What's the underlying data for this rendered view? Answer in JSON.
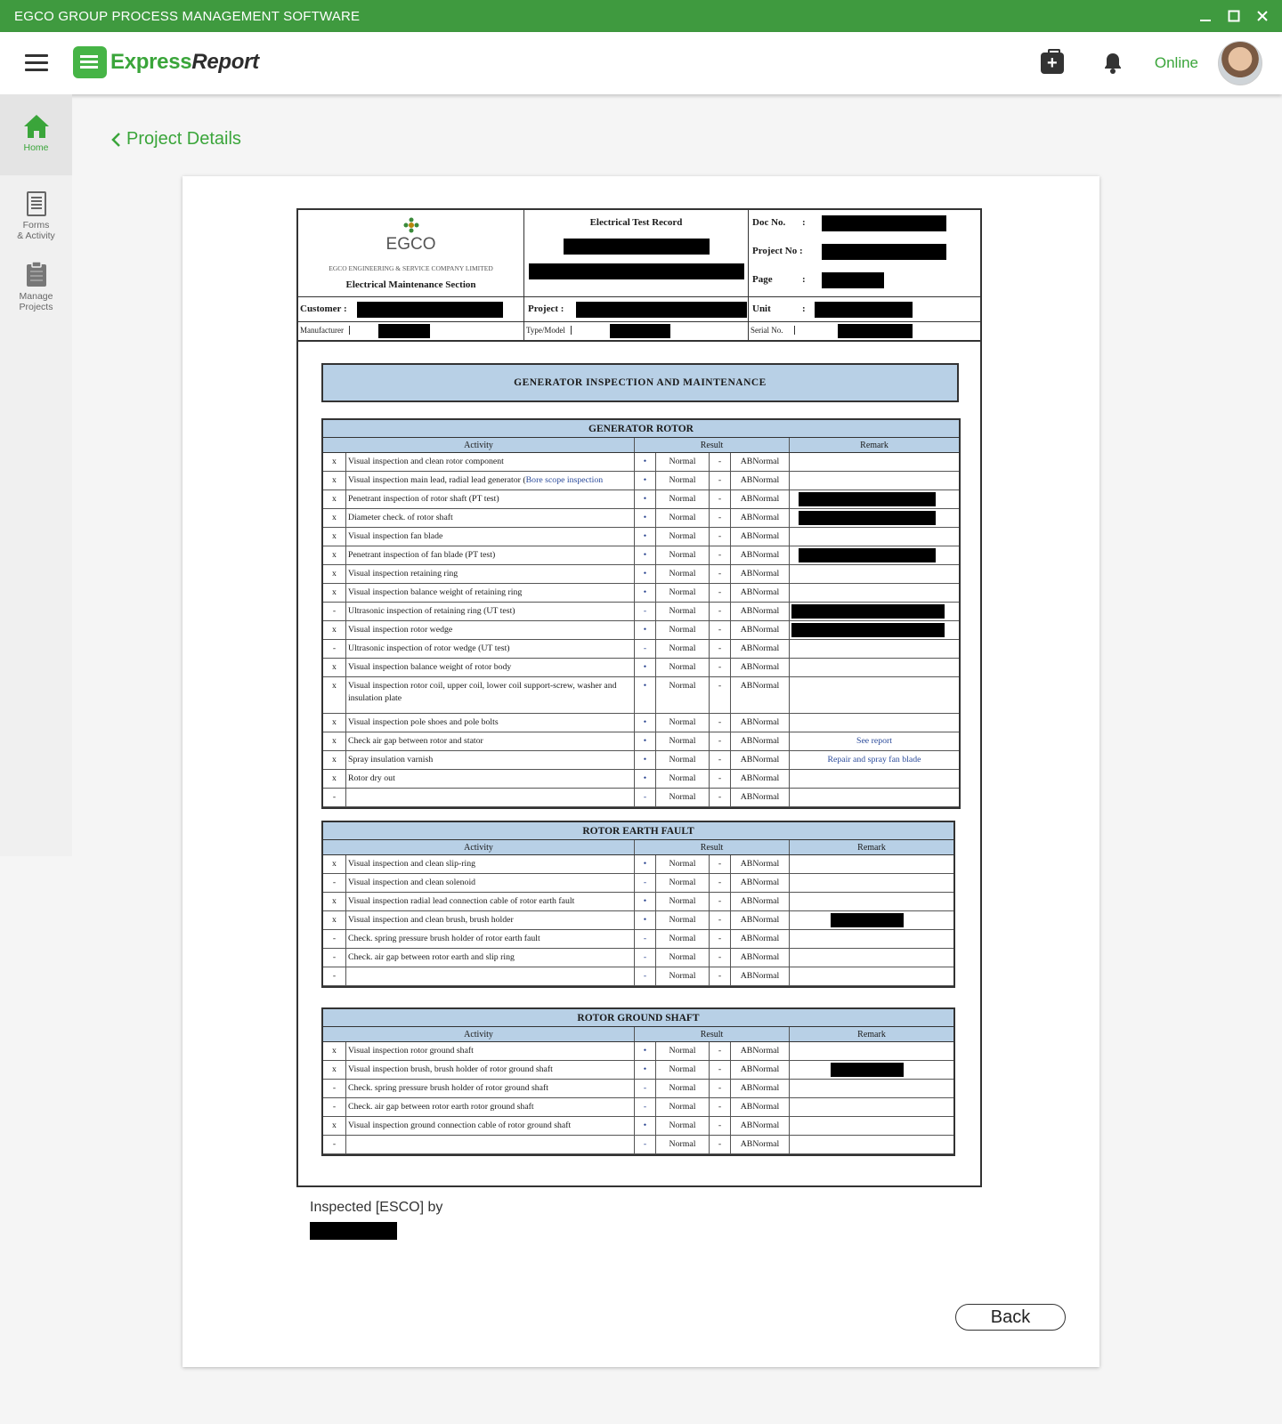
{
  "titlebar": {
    "title": "EGCO GROUP PROCESS MANAGEMENT SOFTWARE"
  },
  "header": {
    "brand_green": "Express",
    "brand_dark": "Report",
    "status": "Online"
  },
  "sidebar": {
    "items": [
      {
        "label_1": "Home",
        "label_2": ""
      },
      {
        "label_1": "Forms",
        "label_2": "& Activity"
      },
      {
        "label_1": "Manage",
        "label_2": "Projects"
      }
    ]
  },
  "breadcrumb": {
    "label": "Project Details"
  },
  "colors": {
    "brand_green": "#3f9a3f",
    "accent_green": "#3aa53a",
    "table_header_blue": "#b8d0e6"
  },
  "doc": {
    "company_logo": "EGCO",
    "company_name": "EGCO ENGINEERING & SERVICE COMPANY LIMITED",
    "section_name": "Electrical Maintenance Section",
    "record_title": "Electrical Test Record",
    "doc_no_label": "Doc No.",
    "project_no_label": "Project No :",
    "page_label": "Page",
    "unit_label": "Unit",
    "customer_label": "Customer :",
    "project_label": "Project :",
    "manufacturer_label": "Manufacturer",
    "type_model_label": "Type/Model",
    "serial_no_label": "Serial No.",
    "colon": ":",
    "banner": "GENERATOR INSPECTION AND MAINTENANCE",
    "col_activity": "Activity",
    "col_result": "Result",
    "col_remark": "Remark",
    "normal": "Normal",
    "abnormal": "ABNormal",
    "dash": "-",
    "rotor_title": "GENERATOR ROTOR",
    "rotor_rows": [
      {
        "mark": "x",
        "activity": "Visual inspection and clean rotor component",
        "dot": "•",
        "remark": ""
      },
      {
        "mark": "x",
        "activity": "Visual inspection main lead, radial lead generator (",
        "activity_blue": "Bore scope inspection",
        "dot": "•",
        "remark": ""
      },
      {
        "mark": "x",
        "activity": "Penetrant inspection of rotor shaft (PT test)",
        "dot": "•",
        "remark": ""
      },
      {
        "mark": "x",
        "activity": "Diameter check. of rotor shaft",
        "dot": "•",
        "remark": ""
      },
      {
        "mark": "x",
        "activity": "Visual inspection fan blade",
        "dot": "•",
        "remark": ""
      },
      {
        "mark": "x",
        "activity": "Penetrant inspection of fan blade (PT test)",
        "dot": "•",
        "remark": ""
      },
      {
        "mark": "x",
        "activity": "Visual inspection retaining ring",
        "dot": "•",
        "remark": ""
      },
      {
        "mark": "x",
        "activity": "Visual inspection balance weight of retaining ring",
        "dot": "•",
        "remark": ""
      },
      {
        "mark": "-",
        "activity": "Ultrasonic inspection of retaining ring (UT test)",
        "dot": "-",
        "remark": ""
      },
      {
        "mark": "x",
        "activity": "Visual inspection rotor wedge",
        "dot": "•",
        "remark": ""
      },
      {
        "mark": "-",
        "activity": "Ultrasonic inspection of rotor wedge (UT test)",
        "dot": "-",
        "remark": ""
      },
      {
        "mark": "x",
        "activity": "Visual inspection balance weight of rotor body",
        "dot": "•",
        "remark": ""
      },
      {
        "mark": "x",
        "activity": "Visual inspection rotor coil, upper coil, lower coil support-screw, washer and insulation plate",
        "dot": "•",
        "remark": ""
      },
      {
        "mark": "x",
        "activity": "Visual inspection pole shoes and pole bolts",
        "dot": "•",
        "remark": ""
      },
      {
        "mark": "x",
        "activity": "Check air gap between rotor and stator",
        "dot": "•",
        "remark": "See report"
      },
      {
        "mark": "x",
        "activity": "Spray insulation varnish",
        "dot": "•",
        "remark": "Repair and spray fan blade"
      },
      {
        "mark": "x",
        "activity": "Rotor dry out",
        "dot": "•",
        "remark": ""
      },
      {
        "mark": "-",
        "activity": "",
        "dot": "-",
        "remark": ""
      }
    ],
    "earth_title": "ROTOR EARTH FAULT",
    "earth_rows": [
      {
        "mark": "x",
        "activity": "Visual inspection and clean slip-ring",
        "dot": "•",
        "remark": ""
      },
      {
        "mark": "-",
        "activity": "Visual inspection and clean solenoid",
        "dot": "-",
        "remark": ""
      },
      {
        "mark": "x",
        "activity": "Visual inspection radial lead connection cable of rotor earth fault",
        "dot": "•",
        "remark": ""
      },
      {
        "mark": "x",
        "activity": "Visual inspection and clean brush, brush holder",
        "dot": "•",
        "remark": ""
      },
      {
        "mark": "-",
        "activity": "Check. spring pressure brush holder of rotor earth fault",
        "dot": "-",
        "remark": ""
      },
      {
        "mark": "-",
        "activity": "Check. air gap between rotor earth and slip ring",
        "dot": "-",
        "remark": ""
      },
      {
        "mark": "-",
        "activity": "",
        "dot": "-",
        "remark": ""
      }
    ],
    "ground_title": "ROTOR GROUND SHAFT",
    "ground_rows": [
      {
        "mark": "x",
        "activity": "Visual inspection rotor ground shaft",
        "dot": "•",
        "remark": ""
      },
      {
        "mark": "x",
        "activity": "Visual inspection brush, brush holder of rotor ground shaft",
        "dot": "•",
        "remark": ""
      },
      {
        "mark": "-",
        "activity": "Check. spring pressure brush holder of rotor ground shaft",
        "dot": "-",
        "remark": ""
      },
      {
        "mark": "-",
        "activity": "Check. air gap between rotor earth rotor ground shaft",
        "dot": "-",
        "remark": ""
      },
      {
        "mark": "x",
        "activity": "Visual inspection ground connection cable of rotor ground shaft",
        "dot": "•",
        "remark": ""
      },
      {
        "mark": "-",
        "activity": "",
        "dot": "-",
        "remark": ""
      }
    ]
  },
  "inspected_label": "Inspected [ESCO] by",
  "back_label": "Back"
}
